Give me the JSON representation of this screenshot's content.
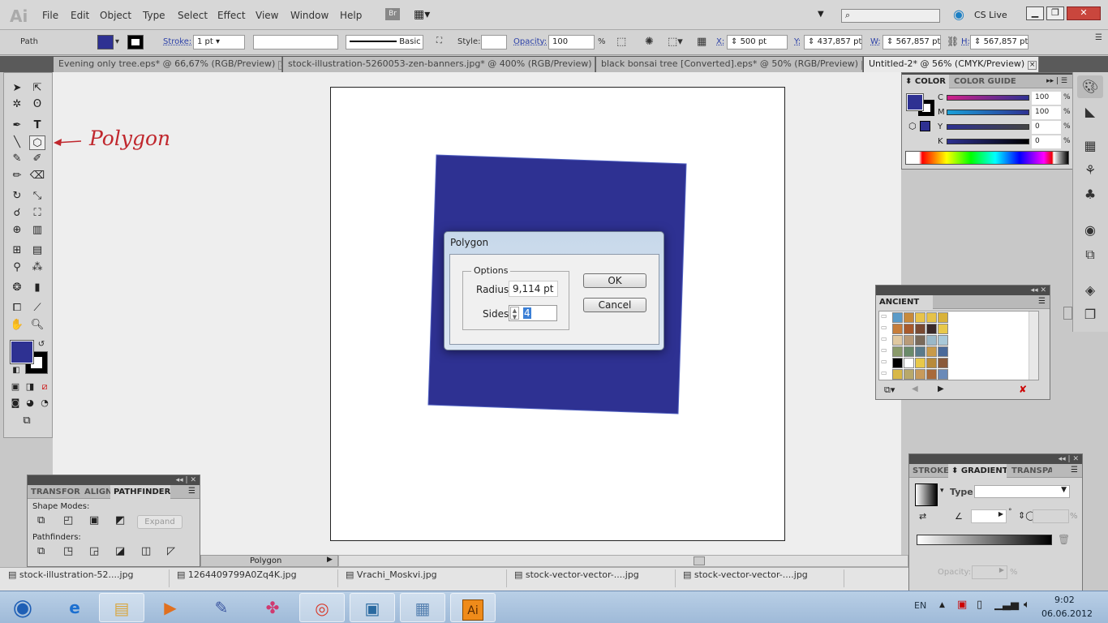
{
  "app": {
    "logo": "Ai",
    "menu": [
      "File",
      "Edit",
      "Object",
      "Type",
      "Select",
      "Effect",
      "View",
      "Window",
      "Help"
    ],
    "bridge": "Br",
    "cs_live": "CS Live",
    "search_placeholder": ""
  },
  "control_bar": {
    "selection": "Path",
    "fill_color": "#2e3192",
    "stroke_label": "Stroke:",
    "stroke_weight": "1 pt",
    "brush_label": "Basic",
    "style_label": "Style:",
    "opacity_label": "Opacity:",
    "opacity_value": "100",
    "opacity_unit": "%",
    "x_label": "X:",
    "x_value": "500 pt",
    "y_label": "Y:",
    "y_value": "437,857 pt",
    "w_label": "W:",
    "w_value": "567,857 pt",
    "h_label": "H:",
    "h_value": "567,857 pt"
  },
  "doc_tabs": [
    {
      "label": "Evening only tree.eps* @ 66,67% (RGB/Preview)",
      "active": false
    },
    {
      "label": "stock-illustration-5260053-zen-banners.jpg* @ 400% (RGB/Preview)",
      "active": false
    },
    {
      "label": "black bonsai tree [Converted].eps* @ 50% (RGB/Preview)",
      "active": false
    },
    {
      "label": "Untitled-2* @ 56% (CMYK/Preview)",
      "active": true
    }
  ],
  "annotation": {
    "text": "Polygon",
    "color": "#c0272d"
  },
  "canvas": {
    "shape_color": "#2e3192"
  },
  "dialog": {
    "title": "Polygon",
    "group": "Options",
    "radius_label": "Radius:",
    "radius_value": "9,114 pt",
    "sides_label": "Sides:",
    "sides_value": "4",
    "ok": "OK",
    "cancel": "Cancel"
  },
  "color_panel": {
    "tabs": [
      "COLOR",
      "COLOR GUIDE"
    ],
    "channels": [
      {
        "name": "C",
        "value": "100",
        "unit": "%"
      },
      {
        "name": "M",
        "value": "100",
        "unit": "%"
      },
      {
        "name": "Y",
        "value": "0",
        "unit": "%"
      },
      {
        "name": "K",
        "value": "0",
        "unit": "%"
      }
    ]
  },
  "swatches_panel": {
    "title": "ANCIENT",
    "colors": [
      "#5b9bc8",
      "#c88a3a",
      "#e8c34a",
      "#e6c24a",
      "#d9b23a",
      "#c77d3a",
      "#a85a2c",
      "#7a4a32",
      "#3a2a2a",
      "#e8c84a",
      "#e0c8a0",
      "#b89a78",
      "#7a6a5a",
      "#9ab8c8",
      "#a8c8d8",
      "#8a9a6a",
      "#6a8a6a",
      "#5a7a8a",
      "#c89a4a",
      "#4a6a9a",
      "#000000",
      "#ffffff",
      "#e8c84a",
      "#b88a3a",
      "#8a5a3a",
      "#d8b848",
      "#b8a86a",
      "#c89a5a",
      "#a86a3a",
      "#6a8ab8"
    ]
  },
  "gradient_panel": {
    "tabs": [
      "STROKE",
      "GRADIENT",
      "TRANSPA"
    ],
    "type_label": "Type:",
    "opacity_label": "Opacity:",
    "opacity_unit": "%",
    "angle_unit": "°",
    "ratio_unit": "%"
  },
  "pathfinder_panel": {
    "tabs": [
      "TRANSFORM",
      "ALIGN",
      "PATHFINDER"
    ],
    "shape_modes_label": "Shape Modes:",
    "expand": "Expand",
    "pathfinders_label": "Pathfinders:"
  },
  "status_bar": {
    "tool": "Polygon"
  },
  "file_bar": [
    "stock-illustration-52....jpg",
    "1264409799A0Zq4K.jpg",
    "Vrachi_Moskvi.jpg",
    "stock-vector-vector-....jpg",
    "stock-vector-vector-....jpg"
  ],
  "taskbar": {
    "apps": [
      "start",
      "internet-explorer",
      "explorer",
      "media-player",
      "paint-app",
      "pinwheel-app",
      "chrome",
      "image-viewer",
      "calculator",
      "illustrator"
    ],
    "lang": "EN",
    "time": "9:02",
    "date": "06.06.2012"
  }
}
